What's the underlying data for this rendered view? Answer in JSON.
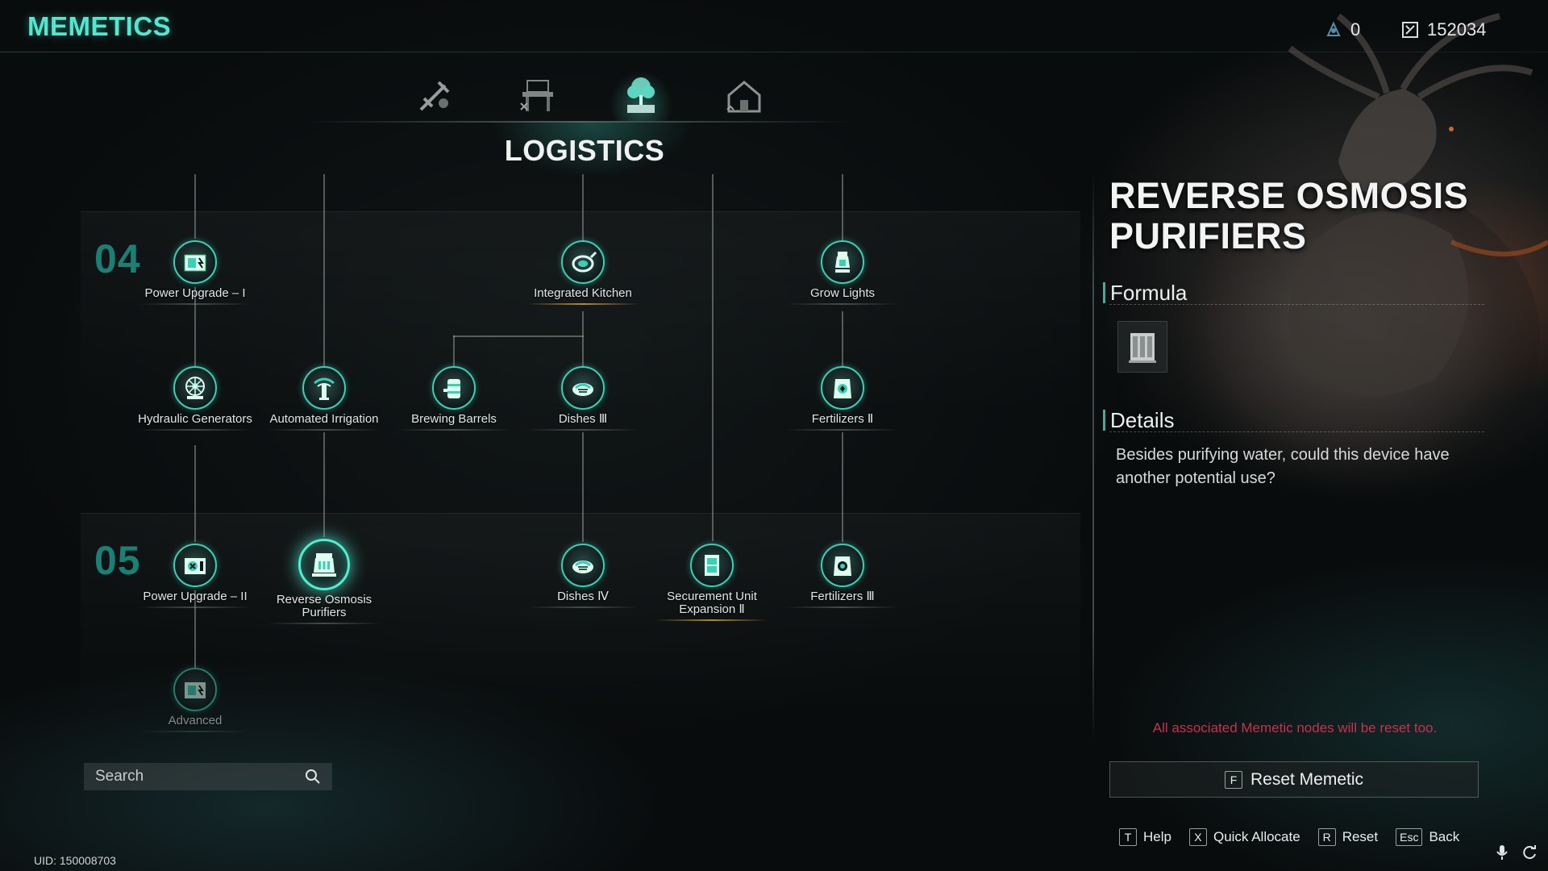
{
  "header": {
    "title": "MEMETICS",
    "currencies": [
      {
        "icon": "memetic-point-icon",
        "value": "0"
      },
      {
        "icon": "crystal-currency-icon",
        "value": "152034"
      }
    ]
  },
  "tabs": [
    {
      "name": "combat-tab",
      "icon": "weapon-icon",
      "active": false
    },
    {
      "name": "crafting-tab",
      "icon": "workbench-icon",
      "active": false
    },
    {
      "name": "logistics-tab",
      "icon": "tree-planter-icon",
      "active": true
    },
    {
      "name": "building-tab",
      "icon": "house-icon",
      "active": false
    }
  ],
  "category": "LOGISTICS",
  "tiers": [
    {
      "label": "04"
    },
    {
      "label": "05"
    }
  ],
  "nodes": [
    {
      "id": "power-upgrade-1",
      "label": "Power Upgrade – I",
      "icon": "generator-icon"
    },
    {
      "id": "integrated-kitchen",
      "label": "Integrated Kitchen",
      "icon": "frying-pan-icon"
    },
    {
      "id": "grow-lights",
      "label": "Grow Lights",
      "icon": "grow-lamp-icon"
    },
    {
      "id": "hydraulic-generators",
      "label": "Hydraulic Generators",
      "icon": "water-wheel-icon"
    },
    {
      "id": "automated-irrigation",
      "label": "Automated Irrigation",
      "icon": "sprinkler-icon"
    },
    {
      "id": "brewing-barrels",
      "label": "Brewing Barrels",
      "icon": "barrel-icon"
    },
    {
      "id": "dishes-3",
      "label": "Dishes Ⅲ",
      "icon": "dish-icon"
    },
    {
      "id": "fertilizers-2",
      "label": "Fertilizers Ⅱ",
      "icon": "fertilizer-bag-icon"
    },
    {
      "id": "power-upgrade-2",
      "label": "Power Upgrade – II",
      "icon": "generator-icon"
    },
    {
      "id": "reverse-osmosis-purifiers",
      "label": "Reverse Osmosis Purifiers",
      "icon": "purifier-icon"
    },
    {
      "id": "dishes-4",
      "label": "Dishes Ⅳ",
      "icon": "dish-icon"
    },
    {
      "id": "securement-unit-expansion-2",
      "label": "Securement Unit Expansion Ⅱ",
      "icon": "container-icon"
    },
    {
      "id": "fertilizers-3",
      "label": "Fertilizers Ⅲ",
      "icon": "fertilizer-bag-icon"
    },
    {
      "id": "advanced",
      "label": "Advanced",
      "icon": "generator-icon"
    }
  ],
  "search": {
    "placeholder": "Search"
  },
  "uid": "UID: 150008703",
  "detail": {
    "title": "REVERSE OSMOSIS PURIFIERS",
    "formula_heading": "Formula",
    "formula_item_icon": "purifier-machine-icon",
    "details_heading": "Details",
    "description": "Besides purifying water, could this device have another potential use?",
    "warning": "All associated Memetic nodes will be reset too.",
    "reset_key": "F",
    "reset_label": "Reset Memetic"
  },
  "hints": [
    {
      "key": "T",
      "label": "Help"
    },
    {
      "key": "X",
      "label": "Quick Allocate"
    },
    {
      "key": "R",
      "label": "Reset"
    },
    {
      "key": "Esc",
      "label": "Back"
    }
  ],
  "system_icons": [
    "microphone-icon",
    "refresh-icon"
  ],
  "colors": {
    "accent": "#55e6cf",
    "tier": "#1a7f75",
    "warning": "#c8324a",
    "gold": "#c8a03c"
  }
}
